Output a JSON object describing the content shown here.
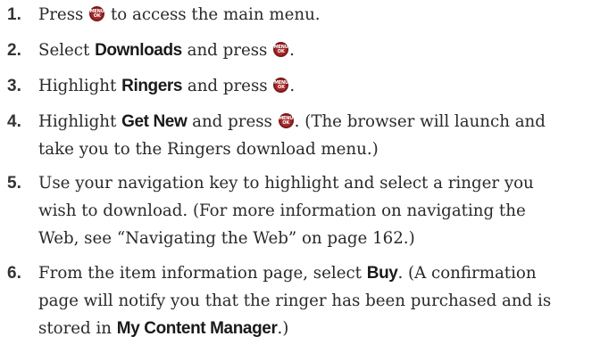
{
  "menu_key": {
    "line1": "MENU",
    "line2": "OK"
  },
  "steps": [
    {
      "number": "1.",
      "lines": [
        {
          "a": "Press ",
          "b": " to access the main menu."
        }
      ]
    },
    {
      "number": "2.",
      "lines": [
        {
          "a": "Select ",
          "bold": "Downloads",
          "b": " and press ",
          "c": "."
        }
      ]
    },
    {
      "number": "3.",
      "lines": [
        {
          "a": "Highlight ",
          "bold": "Ringers",
          "b": " and press ",
          "c": "."
        }
      ]
    },
    {
      "number": "4.",
      "lines": [
        {
          "a": "Highlight ",
          "bold": "Get New",
          "b": " and press ",
          "c": ". (The browser will launch and"
        },
        {
          "a": "take you to the Ringers download menu.)"
        }
      ]
    },
    {
      "number": "5.",
      "lines": [
        {
          "a": "Use your navigation key to highlight and select a ringer you"
        },
        {
          "a": "wish to download. (For more information on navigating the"
        },
        {
          "a": "Web, see “Navigating the Web” on page 162.)"
        }
      ]
    },
    {
      "number": "6.",
      "lines": [
        {
          "a": "From the item information page, select ",
          "bold": "Buy",
          "b": ". (A confirmation"
        },
        {
          "a": "page will notify you that the ringer has been purchased and is"
        },
        {
          "a": "stored in ",
          "bold": "My Content Manager",
          "b": ".)"
        }
      ]
    }
  ]
}
